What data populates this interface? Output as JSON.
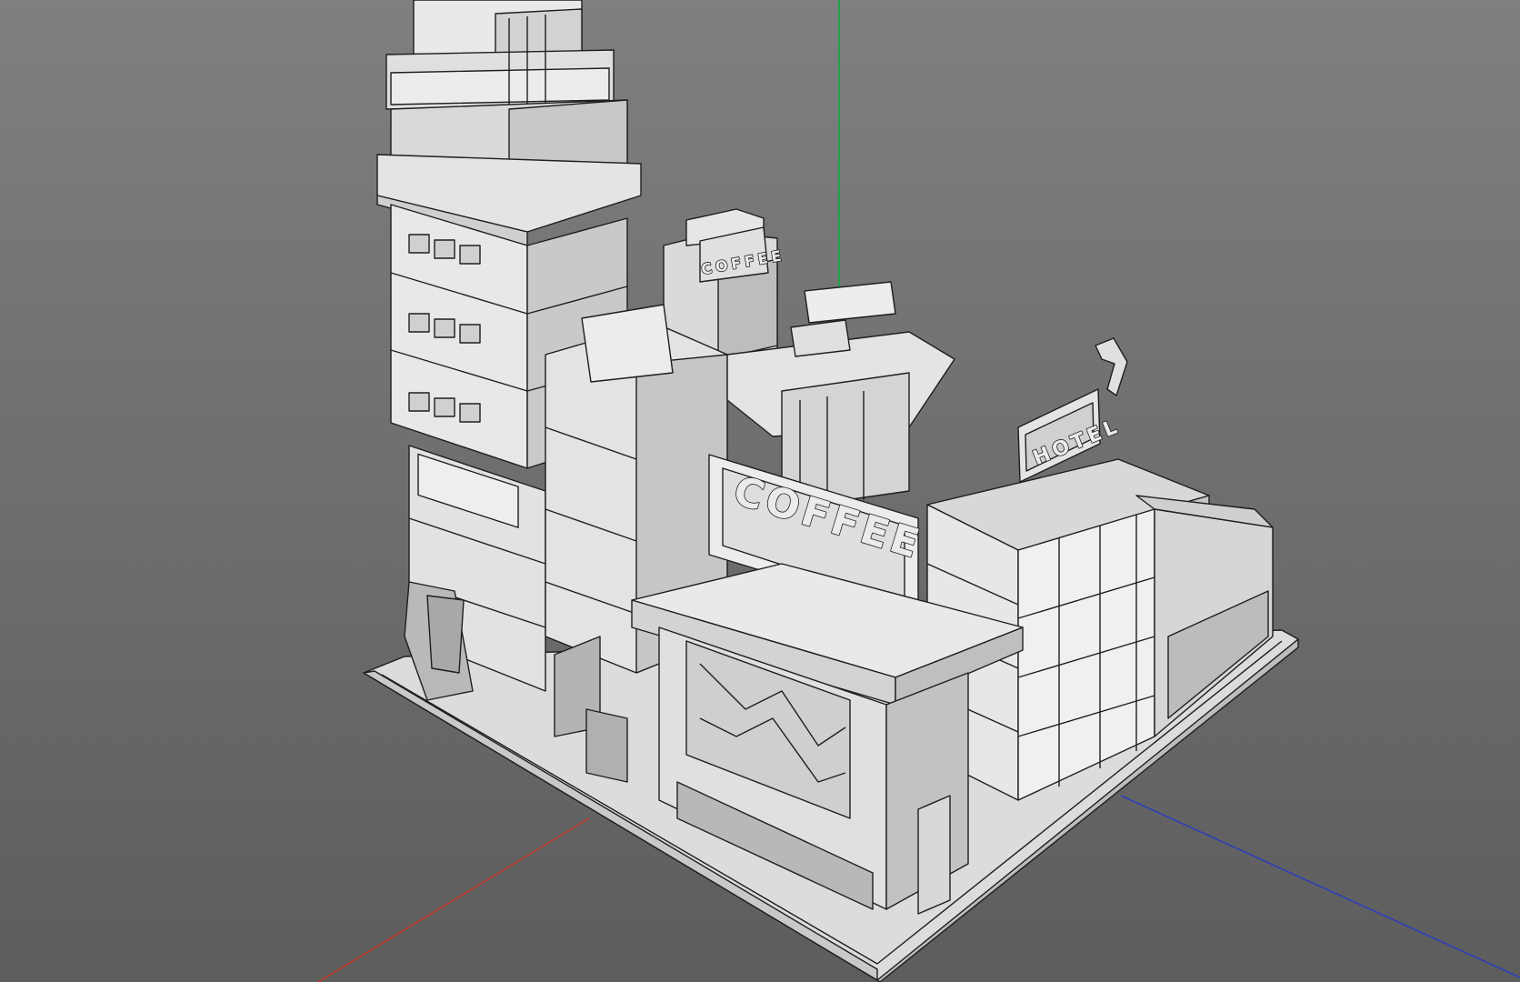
{
  "viewport": {
    "background_top": "#7d7d7d",
    "background_bottom": "#5e5e5e",
    "model_fill": "#e6e6e6",
    "model_shade": "#cfcfcf",
    "model_dark": "#b5b5b5",
    "edge_color": "#1e1e1e",
    "axes": {
      "x_color": "#c0392b",
      "y_color": "#1fa34a",
      "z_color": "#2f3fb8"
    }
  },
  "model": {
    "signs": {
      "main": "COFFEE",
      "upper": "COFFEE",
      "hotel": "HOTEL"
    }
  }
}
